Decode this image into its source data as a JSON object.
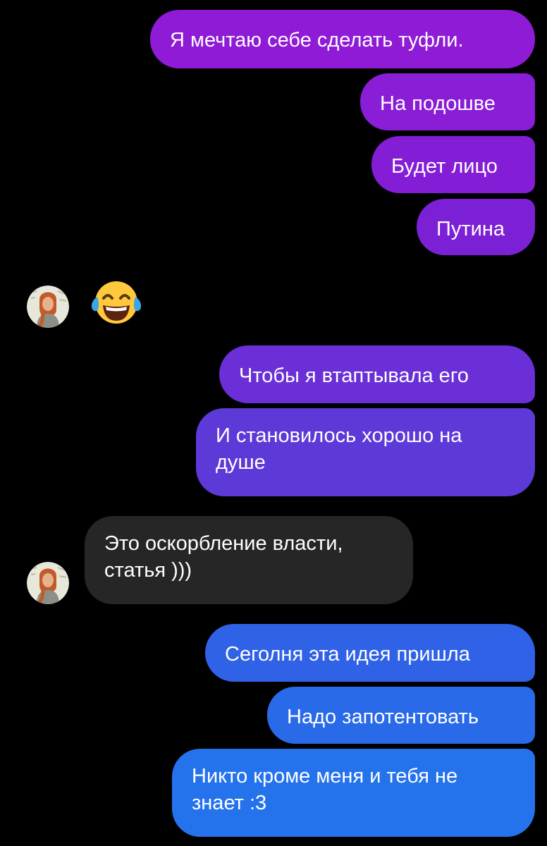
{
  "conversation": {
    "messages": [
      {
        "sender": "me",
        "text": "Я мечтаю себе сделать туфли."
      },
      {
        "sender": "me",
        "text": "На подошве"
      },
      {
        "sender": "me",
        "text": "Будет лицо"
      },
      {
        "sender": "me",
        "text": "Путина"
      },
      {
        "sender": "them",
        "emoji": "face-with-tears-of-joy"
      },
      {
        "sender": "me",
        "text": "Чтобы я втаптывала его"
      },
      {
        "sender": "me",
        "text": "И становилось хорошо на душе"
      },
      {
        "sender": "them",
        "text": "Это оскорбление власти, статья )))"
      },
      {
        "sender": "me",
        "text": "Сеголня эта идея пришла"
      },
      {
        "sender": "me",
        "text": "Надо запотентовать"
      },
      {
        "sender": "me",
        "text": "Никто кроме меня и тебя не знает :3"
      }
    ]
  },
  "colors": {
    "background": "#000000",
    "incoming_bubble": "#262626",
    "outgoing_gradient_top": "#9a1fd6",
    "outgoing_gradient_bottom": "#1f78f0",
    "text": "#ffffff"
  },
  "icons": {
    "avatar": "avatar-portrait",
    "reaction": "face-with-tears-of-joy-icon"
  }
}
